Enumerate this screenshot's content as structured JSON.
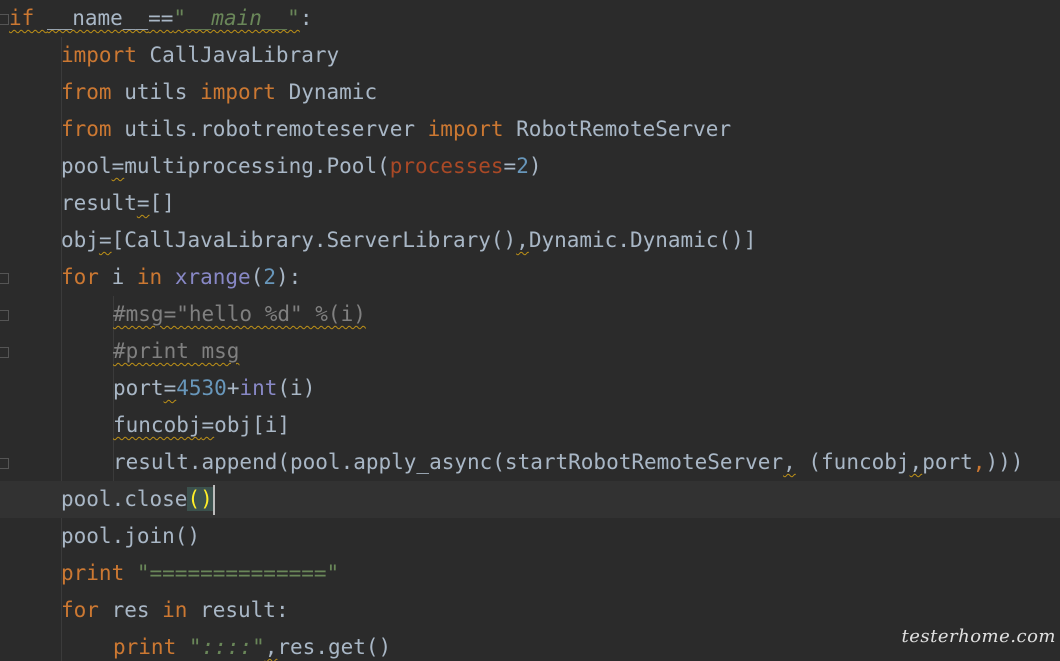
{
  "editor": {
    "lines": {
      "l0": {
        "a": "if ",
        "b": "__name__",
        "c": "==",
        "d": "\"__main__\"",
        "e": ":"
      },
      "l1": {
        "a": "import",
        "b": " CallJavaLibrary"
      },
      "l2": {
        "a": "from",
        "b": " utils ",
        "c": "import",
        "d": " Dynamic"
      },
      "l3": {
        "a": "from",
        "b": " utils.robotremoteserver ",
        "c": "import",
        "d": " RobotRemoteServer"
      },
      "l4": {
        "a": "pool",
        "b": "=",
        "c": "multiprocessing.Pool(",
        "d": "processes",
        "e": "=",
        "f": "2",
        "g": ")"
      },
      "l5": {
        "a": "result",
        "b": "=",
        "c": "[]"
      },
      "l6": {
        "a": "obj",
        "b": "=",
        "c": "[CallJavaLibrary.ServerLibrary()",
        "d": ",",
        "e": "Dynamic.Dynamic()]"
      },
      "l7": {
        "a": "for",
        "b": " i ",
        "c": "in",
        "d": " ",
        "e": "xrange",
        "f": "(",
        "g": "2",
        "h": "):"
      },
      "l8": {
        "a": "#msg=\"hello %d\" %(i)"
      },
      "l9": {
        "a": "#print msg"
      },
      "l10": {
        "a": "port",
        "b": "=",
        "c": "4530",
        "d": "+",
        "e": "int",
        "f": "(i)"
      },
      "l11": {
        "a": "funcobj",
        "b": "=",
        "c": "obj[i]"
      },
      "l12": {
        "a": "result.append(pool.apply_async(startRobotRemoteServer",
        "b": ",",
        "c": " (funcobj",
        "d": ",",
        "e": "port",
        "f": ",",
        "g": ")))"
      },
      "l13": {
        "a": "pool.close",
        "b": "()"
      },
      "l14": {
        "a": "pool.join()"
      },
      "l15": {
        "a": "print",
        "b": " ",
        "c": "\"==============\""
      },
      "l16": {
        "a": "for",
        "b": " res ",
        "c": "in",
        "d": " result:"
      },
      "l17": {
        "a": "print",
        "b": " ",
        "c": "\"::::\"",
        "d": ",",
        "e": "res.get()"
      }
    }
  },
  "watermark": {
    "text": "testerhome.com"
  },
  "colors": {
    "background": "#2b2b2b",
    "keyword": "#cc7832",
    "number": "#6897bb",
    "string": "#6a8759",
    "comment": "#808080",
    "parameter": "#aa4926",
    "builtin": "#8888c6",
    "text": "#a9b7c6"
  }
}
